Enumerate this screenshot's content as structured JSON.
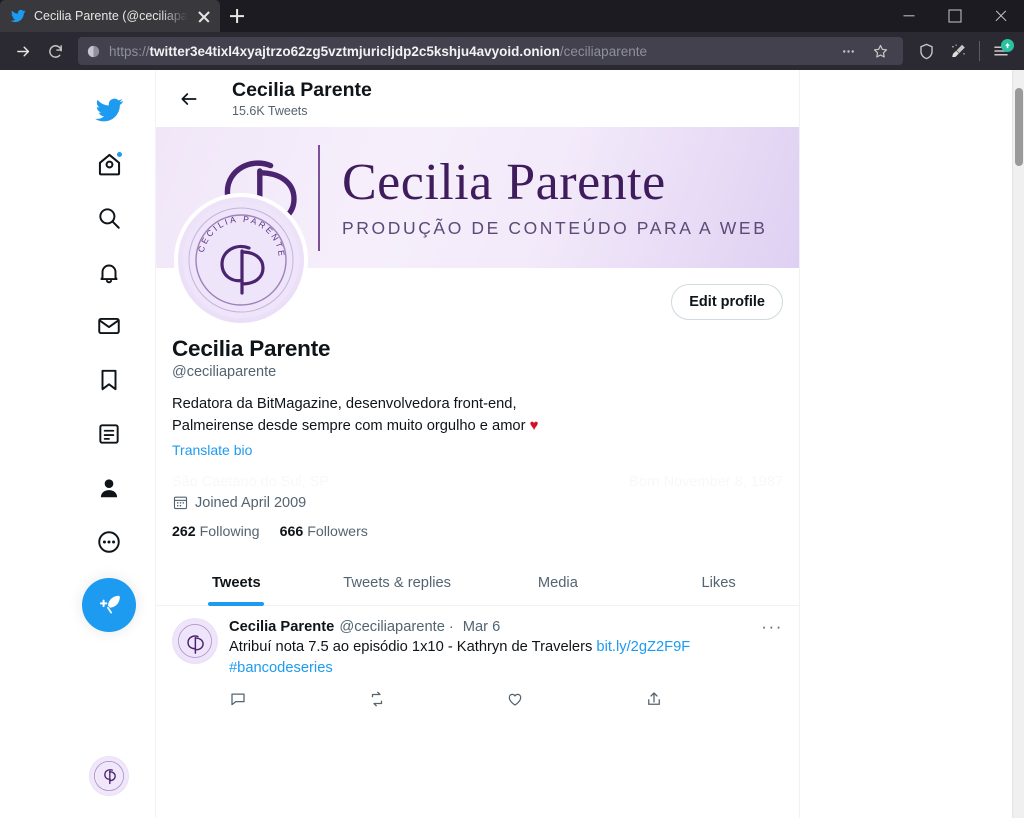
{
  "browser": {
    "tab": {
      "title": "Cecilia Parente (@ceciliaparent",
      "favicon": "twitter-bird-icon"
    },
    "newtab_label": "+",
    "window": {
      "minimize": "minimize-icon",
      "maximize": "maximize-icon",
      "close": "close-icon"
    },
    "nav": {
      "forward": "forward-arrow-icon",
      "reload": "reload-icon"
    },
    "url": {
      "scheme": "https://",
      "host": "twitter3e4tixl4xyajtrzo62zg5vztmjuricljdp2c5kshju4avyoid.onion",
      "path": "/ceciliaparente",
      "security_icon": "onion-icon"
    },
    "toolbar_icons": [
      "page-actions-dots-icon",
      "bookmark-star-icon",
      "shield-icon",
      "new-identity-broom-icon",
      "app-menu-icon"
    ],
    "update_badge": "update-arrow-icon"
  },
  "sidebar": {
    "items": [
      {
        "name": "twitter-logo",
        "icon": "twitter-bird-icon"
      },
      {
        "name": "home",
        "icon": "home-icon",
        "badge": true
      },
      {
        "name": "explore",
        "icon": "search-icon"
      },
      {
        "name": "notifications",
        "icon": "bell-icon"
      },
      {
        "name": "messages",
        "icon": "mail-icon"
      },
      {
        "name": "bookmarks",
        "icon": "bookmark-icon"
      },
      {
        "name": "lists",
        "icon": "list-icon"
      },
      {
        "name": "profile",
        "icon": "person-icon"
      },
      {
        "name": "more",
        "icon": "more-circle-icon"
      }
    ],
    "compose": {
      "icon": "compose-feather-icon"
    },
    "account_avatar": "avatar-icon"
  },
  "profile_header": {
    "back": "back-arrow-icon",
    "title": "Cecilia Parente",
    "tweet_count": "15.6K Tweets"
  },
  "banner": {
    "logo_name": "Cecilia Parente",
    "tagline": "PRODUÇÃO DE CONTEÚDO PARA A WEB",
    "colors": {
      "start": "#f0e6f8",
      "end": "#ded0f2",
      "ink": "#3f1d5c"
    }
  },
  "profile": {
    "edit_button": "Edit profile",
    "display_name": "Cecilia Parente",
    "handle": "@ceciliaparente",
    "bio_line1": "Redatora da BitMagazine, desenvolvedora front-end,",
    "bio_line2": "Palmeirense desde sempre com muito orgulho e amor",
    "bio_emoji": "♥",
    "translate_bio": "Translate bio",
    "ghost_location": "São Caetano do Sul, SP",
    "ghost_birth": "Born November 8, 1987",
    "joined_icon": "calendar-icon",
    "joined": "Joined April 2009",
    "following_count": "262",
    "following_label": "Following",
    "followers_count": "666",
    "followers_label": "Followers"
  },
  "tabs": [
    {
      "label": "Tweets",
      "active": true
    },
    {
      "label": "Tweets & replies",
      "active": false
    },
    {
      "label": "Media",
      "active": false
    },
    {
      "label": "Likes",
      "active": false
    }
  ],
  "tweet": {
    "author": "Cecilia Parente",
    "handle": "@ceciliaparente",
    "separator": "·",
    "date": "Mar 6",
    "more": "···",
    "text": "Atribuí nota 7.5 ao episódio 1x10 - Kathryn de Travelers ",
    "link": "bit.ly/2gZ2F9F",
    "hashtag": "#bancodeseries",
    "actions": [
      "reply-icon",
      "retweet-icon",
      "like-icon",
      "share-icon"
    ]
  },
  "theme": {
    "accent": "#1d9bf0",
    "text": "#0f1419",
    "muted": "#536471",
    "border": "#eff3f4"
  }
}
